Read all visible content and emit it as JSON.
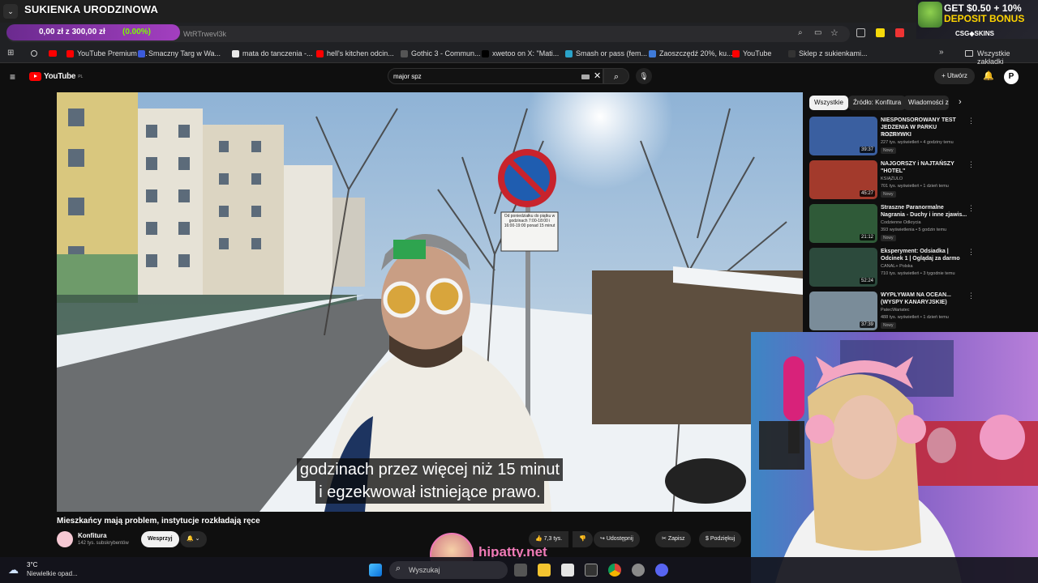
{
  "overlay": {
    "title": "SUKIENKA URODZINOWA",
    "progress_text": "0,00 zł z 300,00 zł",
    "progress_percent": "(0.00%)",
    "progress_value": 0.0,
    "promo_line1": "GET $0.50 + 10%",
    "promo_line2": "DEPOSIT BONUS",
    "promo_brand": "CSG◆SKINS",
    "watermark": "hipatty.net"
  },
  "browser": {
    "url_fragment": "WtRTrwevl3k",
    "bookmarks": [
      {
        "label": "YouTube Premium -...",
        "color": "#ff0000"
      },
      {
        "label": "Smaczny Targ w Wa...",
        "color": "#3b5bdb"
      },
      {
        "label": "mata do tanczenia -...",
        "color": "#e8e8e8"
      },
      {
        "label": "hell's kitchen odcin...",
        "color": "#ff0000"
      },
      {
        "label": "Gothic 3 - Commun...",
        "color": "#555555"
      },
      {
        "label": "xwetoo on X: \"Mati...",
        "color": "#000000"
      },
      {
        "label": "Smash or pass (fem...",
        "color": "#2aa3c9"
      },
      {
        "label": "Zaoszczędź 20%, ku...",
        "color": "#3f7bd9"
      },
      {
        "label": "YouTube",
        "color": "#ff0000"
      },
      {
        "label": "Sklep z sukienkami...",
        "color": "#333333"
      }
    ],
    "all_bookmarks": "Wszystkie zakładki"
  },
  "youtube": {
    "logo": "YouTube",
    "region": "PL",
    "search_value": "major spz",
    "create_label": "Utwórz",
    "video_title": "Mieszkańcy mają problem, instytucje rozkładają ręce",
    "channel_name": "Konfitura",
    "subscribers": "142 tys. subskrybentów",
    "support_label": "Wesprzyj",
    "likes": "7,3 tys.",
    "share_label": "Udostępnij",
    "save_label": "Zapisz",
    "thanks_label": "Podziękuj",
    "subtitle_line1": "godzinach przez więcej niż 15 minut",
    "subtitle_line2": "i egzekwował istniejące prawo.",
    "sign_text": "Od poniedziałku do piątku w godzinach 7:00-18:00 i 16:00-19:00 ponad 15 minut",
    "chips": [
      "Wszystkie",
      "Źródło: Konfitura",
      "Wiadomości ze"
    ],
    "recommendations": [
      {
        "title": "NIESPONSOROWANY TEST JEDZENIA W PARKU ROZRYWKI",
        "channel": "KSIĄŻULO",
        "meta": "227 tys. wyświetleń • 4 godziny temu",
        "badge": "Nowy",
        "duration": "39:37",
        "thumb_color": "#3a5fa0"
      },
      {
        "title": "NAJGORSZY i NAJTAŃSZY \"HOTEL\"",
        "channel": "KSIĄŻULO",
        "meta": "701 tys. wyświetleń • 1 dzień temu",
        "badge": "Nowy",
        "duration": "45:27",
        "thumb_color": "#a33a2c"
      },
      {
        "title": "Straszne Paranormalne Nagrania - Duchy i inne zjawis...",
        "channel": "Codzienne Odkrycia",
        "meta": "393 wyświetlenia • 5 godzin temu",
        "badge": "Nowy",
        "duration": "21:12",
        "thumb_color": "#2f5a38"
      },
      {
        "title": "Eksperyment: Odsiadka | Odcinek 1 | Oglądaj za darmo",
        "channel": "CANAL+ Polska",
        "meta": "710 tys. wyświetleń • 3 tygodnie temu",
        "badge": "",
        "duration": "52:24",
        "thumb_color": "#2c4a3c"
      },
      {
        "title": "WYPŁYWAM NA OCEAN... (WYSPY KANARYJSKIE)",
        "channel": "PatecWariatec",
        "meta": "488 tys. wyświetleń • 1 dzień temu",
        "badge": "Nowy",
        "duration": "37:39",
        "thumb_color": "#7a8c99"
      }
    ]
  },
  "taskbar": {
    "temperature": "3°C",
    "weather": "Niewielkie opad...",
    "search_placeholder": "Wyszukaj"
  },
  "colors": {
    "accent_red": "#ff0000",
    "progress_green": "#7CFC00",
    "promo_yellow": "#ffd400"
  }
}
